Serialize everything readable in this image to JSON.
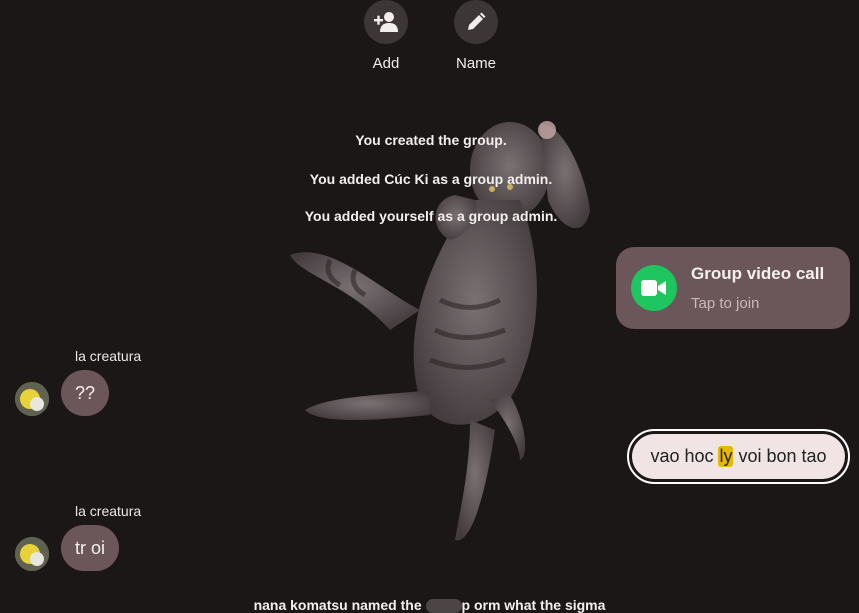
{
  "actions": [
    {
      "label": "Add",
      "icon": "add-person-icon"
    },
    {
      "label": "Name",
      "icon": "pencil-icon"
    }
  ],
  "system_messages": [
    "You created the group.",
    "You added Cúc Ki as a group admin.",
    "You added yourself as a group admin."
  ],
  "call": {
    "title": "Group video call",
    "subtitle": "Tap to join",
    "icon": "video-camera-icon",
    "accent": "#1fc55e"
  },
  "messages": [
    {
      "sender": "la creatura",
      "text": "??"
    },
    {
      "sender": "la creatura",
      "text": "tr oi"
    }
  ],
  "outgoing": {
    "before": "vao hoc ",
    "highlight": "ly",
    "after": " voi bon tao"
  },
  "bottom_notice": {
    "before": "nana komatsu named the ",
    "after": "p orm what the sigma"
  },
  "colors": {
    "background": "#1c1717",
    "bubble": "#6b5659",
    "outgoing_bubble": "#f1e4e5",
    "highlight": "#e6b800"
  }
}
